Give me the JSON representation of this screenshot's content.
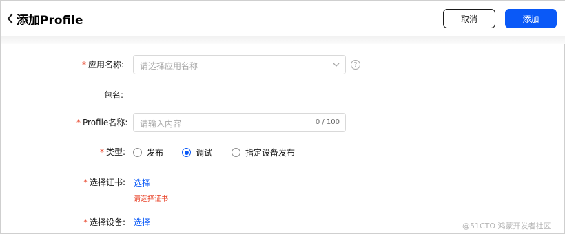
{
  "header": {
    "title": "添加Profile",
    "cancel_label": "取消",
    "add_label": "添加"
  },
  "form": {
    "app_name": {
      "label": "应用名称:",
      "required": "*",
      "placeholder": "请选择应用名称"
    },
    "package_name": {
      "label": "包名:"
    },
    "profile_name": {
      "label": "Profile名称:",
      "required": "*",
      "placeholder": "请输入内容",
      "counter": "0 / 100"
    },
    "type": {
      "label": "类型:",
      "required": "*",
      "options": [
        {
          "label": "发布",
          "checked": false
        },
        {
          "label": "调试",
          "checked": true
        },
        {
          "label": "指定设备发布",
          "checked": false
        }
      ]
    },
    "certificate": {
      "label": "选择证书:",
      "required": "*",
      "link": "选择",
      "error": "请选择证书"
    },
    "device": {
      "label": "选择设备:",
      "required": "*",
      "link": "选择"
    }
  },
  "watermark": "@51CTO 鸿蒙开发者社区",
  "colors": {
    "primary": "#0a59f7",
    "required": "#e84026",
    "error": "#e84026",
    "placeholder": "#a8a8a8"
  }
}
